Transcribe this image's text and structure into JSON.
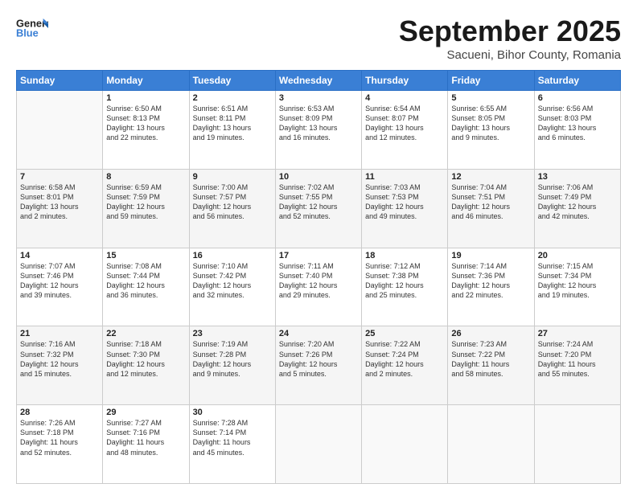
{
  "header": {
    "logo_general": "General",
    "logo_blue": "Blue",
    "month": "September 2025",
    "location": "Sacueni, Bihor County, Romania"
  },
  "days_of_week": [
    "Sunday",
    "Monday",
    "Tuesday",
    "Wednesday",
    "Thursday",
    "Friday",
    "Saturday"
  ],
  "weeks": [
    [
      {
        "day": "",
        "info": ""
      },
      {
        "day": "1",
        "info": "Sunrise: 6:50 AM\nSunset: 8:13 PM\nDaylight: 13 hours\nand 22 minutes."
      },
      {
        "day": "2",
        "info": "Sunrise: 6:51 AM\nSunset: 8:11 PM\nDaylight: 13 hours\nand 19 minutes."
      },
      {
        "day": "3",
        "info": "Sunrise: 6:53 AM\nSunset: 8:09 PM\nDaylight: 13 hours\nand 16 minutes."
      },
      {
        "day": "4",
        "info": "Sunrise: 6:54 AM\nSunset: 8:07 PM\nDaylight: 13 hours\nand 12 minutes."
      },
      {
        "day": "5",
        "info": "Sunrise: 6:55 AM\nSunset: 8:05 PM\nDaylight: 13 hours\nand 9 minutes."
      },
      {
        "day": "6",
        "info": "Sunrise: 6:56 AM\nSunset: 8:03 PM\nDaylight: 13 hours\nand 6 minutes."
      }
    ],
    [
      {
        "day": "7",
        "info": "Sunrise: 6:58 AM\nSunset: 8:01 PM\nDaylight: 13 hours\nand 2 minutes."
      },
      {
        "day": "8",
        "info": "Sunrise: 6:59 AM\nSunset: 7:59 PM\nDaylight: 12 hours\nand 59 minutes."
      },
      {
        "day": "9",
        "info": "Sunrise: 7:00 AM\nSunset: 7:57 PM\nDaylight: 12 hours\nand 56 minutes."
      },
      {
        "day": "10",
        "info": "Sunrise: 7:02 AM\nSunset: 7:55 PM\nDaylight: 12 hours\nand 52 minutes."
      },
      {
        "day": "11",
        "info": "Sunrise: 7:03 AM\nSunset: 7:53 PM\nDaylight: 12 hours\nand 49 minutes."
      },
      {
        "day": "12",
        "info": "Sunrise: 7:04 AM\nSunset: 7:51 PM\nDaylight: 12 hours\nand 46 minutes."
      },
      {
        "day": "13",
        "info": "Sunrise: 7:06 AM\nSunset: 7:49 PM\nDaylight: 12 hours\nand 42 minutes."
      }
    ],
    [
      {
        "day": "14",
        "info": "Sunrise: 7:07 AM\nSunset: 7:46 PM\nDaylight: 12 hours\nand 39 minutes."
      },
      {
        "day": "15",
        "info": "Sunrise: 7:08 AM\nSunset: 7:44 PM\nDaylight: 12 hours\nand 36 minutes."
      },
      {
        "day": "16",
        "info": "Sunrise: 7:10 AM\nSunset: 7:42 PM\nDaylight: 12 hours\nand 32 minutes."
      },
      {
        "day": "17",
        "info": "Sunrise: 7:11 AM\nSunset: 7:40 PM\nDaylight: 12 hours\nand 29 minutes."
      },
      {
        "day": "18",
        "info": "Sunrise: 7:12 AM\nSunset: 7:38 PM\nDaylight: 12 hours\nand 25 minutes."
      },
      {
        "day": "19",
        "info": "Sunrise: 7:14 AM\nSunset: 7:36 PM\nDaylight: 12 hours\nand 22 minutes."
      },
      {
        "day": "20",
        "info": "Sunrise: 7:15 AM\nSunset: 7:34 PM\nDaylight: 12 hours\nand 19 minutes."
      }
    ],
    [
      {
        "day": "21",
        "info": "Sunrise: 7:16 AM\nSunset: 7:32 PM\nDaylight: 12 hours\nand 15 minutes."
      },
      {
        "day": "22",
        "info": "Sunrise: 7:18 AM\nSunset: 7:30 PM\nDaylight: 12 hours\nand 12 minutes."
      },
      {
        "day": "23",
        "info": "Sunrise: 7:19 AM\nSunset: 7:28 PM\nDaylight: 12 hours\nand 9 minutes."
      },
      {
        "day": "24",
        "info": "Sunrise: 7:20 AM\nSunset: 7:26 PM\nDaylight: 12 hours\nand 5 minutes."
      },
      {
        "day": "25",
        "info": "Sunrise: 7:22 AM\nSunset: 7:24 PM\nDaylight: 12 hours\nand 2 minutes."
      },
      {
        "day": "26",
        "info": "Sunrise: 7:23 AM\nSunset: 7:22 PM\nDaylight: 11 hours\nand 58 minutes."
      },
      {
        "day": "27",
        "info": "Sunrise: 7:24 AM\nSunset: 7:20 PM\nDaylight: 11 hours\nand 55 minutes."
      }
    ],
    [
      {
        "day": "28",
        "info": "Sunrise: 7:26 AM\nSunset: 7:18 PM\nDaylight: 11 hours\nand 52 minutes."
      },
      {
        "day": "29",
        "info": "Sunrise: 7:27 AM\nSunset: 7:16 PM\nDaylight: 11 hours\nand 48 minutes."
      },
      {
        "day": "30",
        "info": "Sunrise: 7:28 AM\nSunset: 7:14 PM\nDaylight: 11 hours\nand 45 minutes."
      },
      {
        "day": "",
        "info": ""
      },
      {
        "day": "",
        "info": ""
      },
      {
        "day": "",
        "info": ""
      },
      {
        "day": "",
        "info": ""
      }
    ]
  ]
}
